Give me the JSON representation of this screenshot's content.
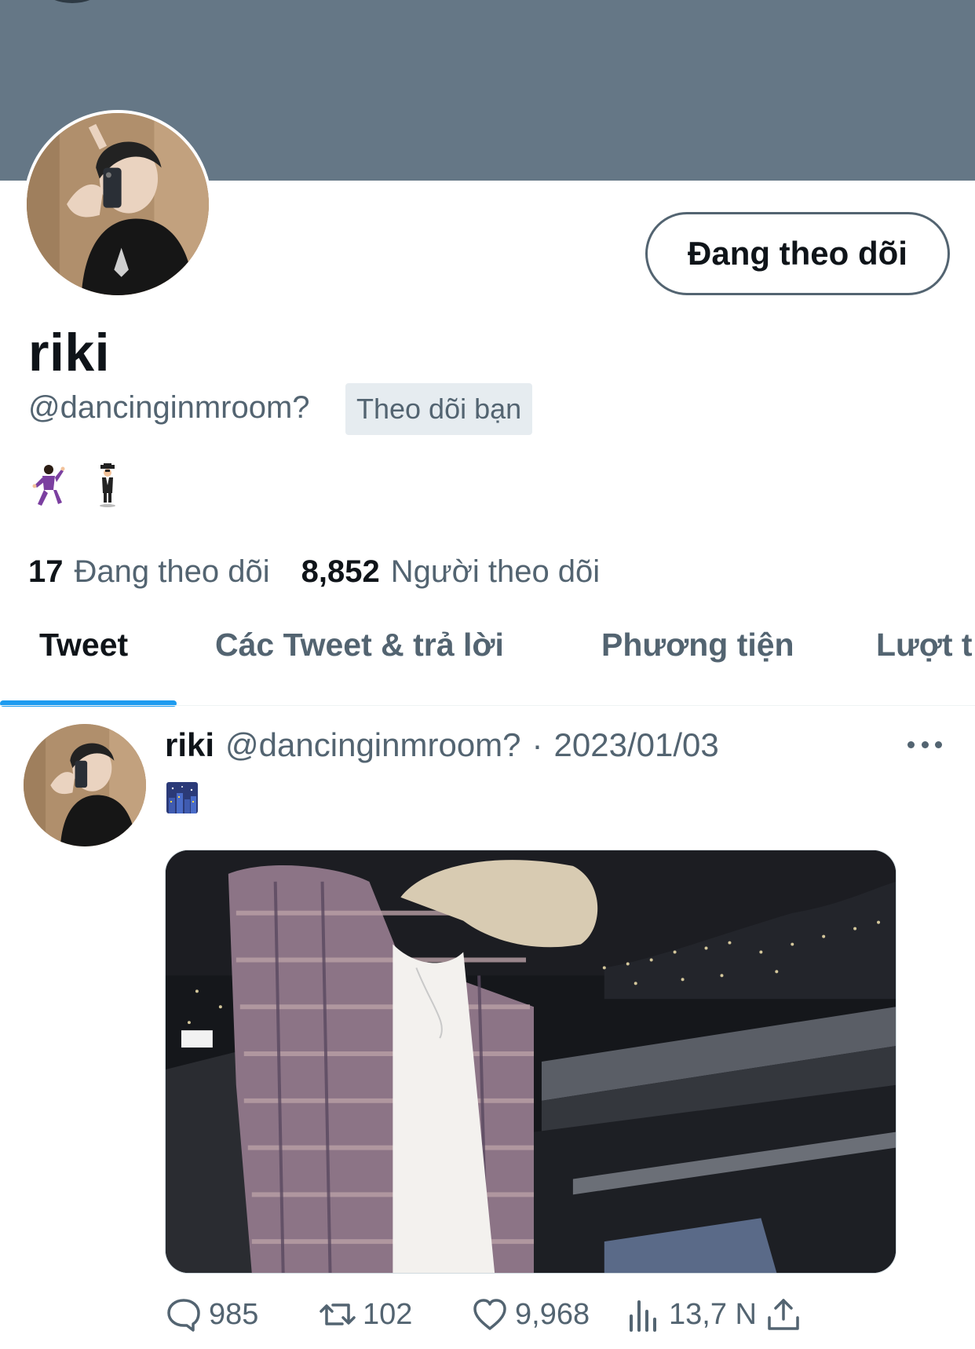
{
  "profile": {
    "display_name": "riki",
    "handle": "@dancinginmroom?",
    "follows_you_label": "Theo dõi bạn",
    "follow_button_label": "Đang theo dõi",
    "bio_emojis": [
      "man-dancing-emoji",
      "man-in-suit-levitating-emoji"
    ],
    "stats": {
      "following_count": "17",
      "following_label": "Đang theo dõi",
      "followers_count": "8,852",
      "followers_label": "Người theo dõi"
    }
  },
  "tabs": [
    {
      "label": "Tweet",
      "active": true
    },
    {
      "label": "Các Tweet & trả lời",
      "active": false
    },
    {
      "label": "Phương tiện",
      "active": false
    },
    {
      "label": "Lượt t",
      "active": false
    }
  ],
  "tweet": {
    "name": "riki",
    "handle": "@dancinginmroom?",
    "separator": "·",
    "date": "2023/01/03",
    "content_emoji": "night-with-stars-emoji",
    "actions": {
      "replies": "985",
      "retweets": "102",
      "likes": "9,968",
      "views": "13,7 N"
    }
  },
  "colors": {
    "banner": "#657786",
    "accent": "#1d9bf0",
    "secondary_text": "#536471",
    "primary_text": "#0f1419"
  }
}
